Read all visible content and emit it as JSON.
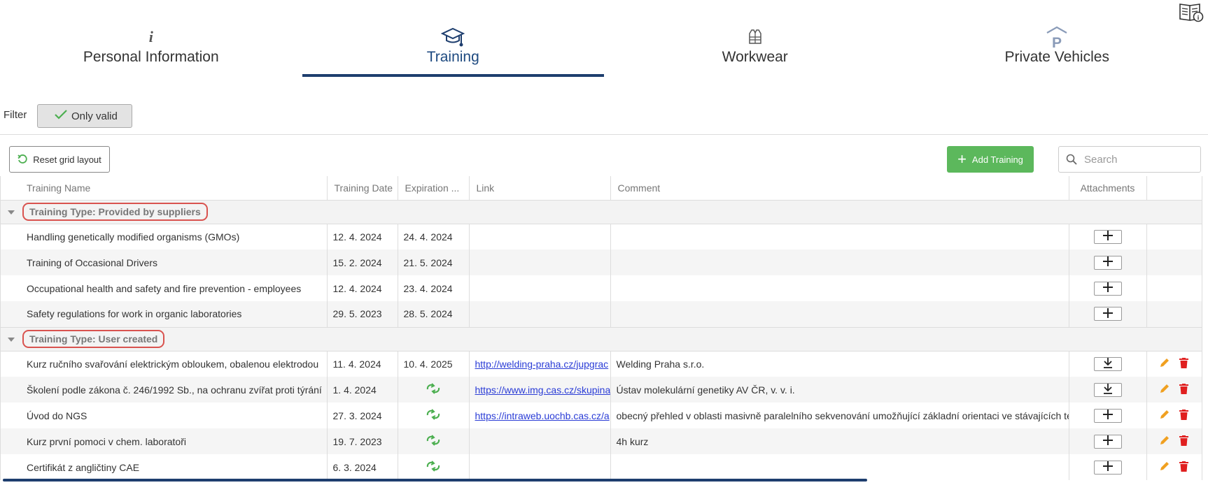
{
  "header": {
    "manual_icon": "user-manual-icon"
  },
  "tabs": [
    {
      "label": "Personal Information",
      "icon": "info-icon",
      "active": false
    },
    {
      "label": "Training",
      "icon": "graduation-cap-icon",
      "active": true
    },
    {
      "label": "Workwear",
      "icon": "vest-icon",
      "active": false
    },
    {
      "label": "Private Vehicles",
      "icon": "parking-icon",
      "active": false
    }
  ],
  "filter": {
    "label": "Filter",
    "only_valid_label": "Only valid",
    "only_valid_checked": true
  },
  "toolbar": {
    "reset_label": "Reset grid layout",
    "add_label": "Add Training",
    "search_placeholder": "Search"
  },
  "columns": [
    "Training Name",
    "Training Date",
    "Expiration ...",
    "Link",
    "Comment",
    "Attachments",
    ""
  ],
  "groups": [
    {
      "label": "Training Type: Provided by suppliers",
      "rows": [
        {
          "name": "Handling genetically modified organisms (GMOs)",
          "date": "12. 4. 2024",
          "expiration": "24. 4. 2024",
          "link": "",
          "comment": "",
          "attachment": "add",
          "editable": false
        },
        {
          "name": "Training of Occasional Drivers",
          "date": "15. 2. 2024",
          "expiration": "21. 5. 2024",
          "link": "",
          "comment": "",
          "attachment": "add",
          "editable": false
        },
        {
          "name": "Occupational health and safety and fire prevention - employees",
          "date": "12. 4. 2024",
          "expiration": "23. 4. 2024",
          "link": "",
          "comment": "",
          "attachment": "add",
          "editable": false
        },
        {
          "name": "Safety regulations for work in organic laboratories",
          "date": "29. 5. 2023",
          "expiration": "28. 5. 2024",
          "link": "",
          "comment": "",
          "attachment": "add",
          "editable": false
        }
      ]
    },
    {
      "label": "Training Type: User created",
      "rows": [
        {
          "name": "Kurz ručního svařování elektrickým obloukem, obalenou elektrodou",
          "date": "11. 4. 2024",
          "expiration": "10. 4. 2025",
          "link": "http://welding-praha.cz/jupgrac",
          "comment": "Welding Praha s.r.o.",
          "attachment": "download",
          "editable": true
        },
        {
          "name": "Školení podle zákona č. 246/1992 Sb., na ochranu zvířat proti týrání",
          "date": "1. 4. 2024",
          "expiration": "recurring-icon",
          "link": "https://www.img.cas.cz/skupina",
          "comment": "Ústav molekulární genetiky AV ČR, v. v. i.",
          "attachment": "download",
          "editable": true
        },
        {
          "name": "Úvod do NGS",
          "date": "27. 3. 2024",
          "expiration": "recurring-icon",
          "link": "https://intraweb.uochb.cas.cz/a",
          "comment": "obecný přehled v oblasti masivně paralelního sekvenování umožňující základní orientaci ve stávajících te",
          "attachment": "add",
          "editable": true
        },
        {
          "name": "Kurz první pomoci v chem. laboratoři",
          "date": "19. 7. 2023",
          "expiration": "recurring-icon",
          "link": "",
          "comment": "4h kurz",
          "attachment": "add",
          "editable": true
        },
        {
          "name": "Certifikát z angličtiny CAE",
          "date": "6. 3. 2024",
          "expiration": "recurring-icon",
          "link": "",
          "comment": "",
          "attachment": "add",
          "editable": true
        }
      ]
    }
  ],
  "colors": {
    "accent": "#1e3e6e",
    "add_green": "#5cb85c",
    "edit_orange": "#f0a020",
    "delete_red": "#e02020",
    "group_highlight": "#d9534f"
  }
}
